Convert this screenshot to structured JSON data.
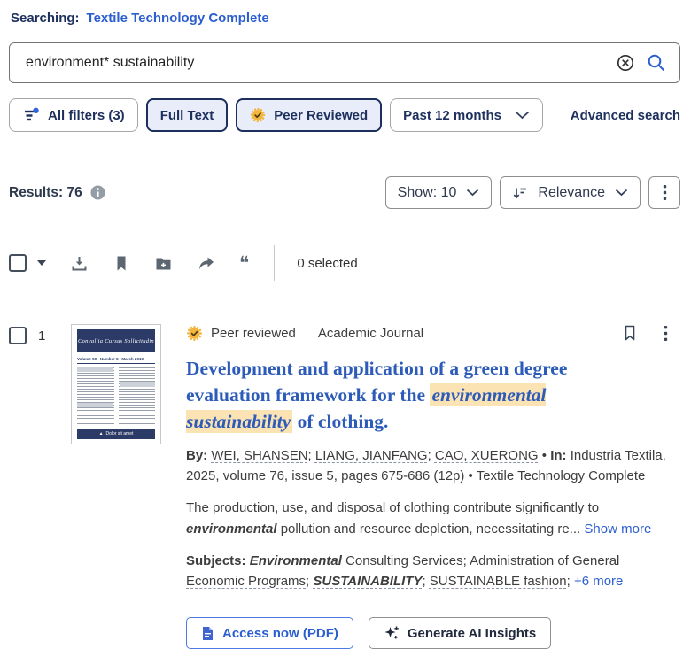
{
  "colors": {
    "navy": "#1c2f5d",
    "link_blue": "#2b5fd0",
    "title_blue": "#2d5bb9",
    "highlight": "#fbe3b4",
    "badge_gold": "#f3b53d",
    "icon_gray": "#5b6670",
    "selected_filter_bg": "#e8edf9"
  },
  "searching": {
    "label": "Searching:",
    "database_link": "Textile Technology Complete"
  },
  "search": {
    "value": "environment* sustainability",
    "clear_icon": "circled-x",
    "submit_icon": "magnifier"
  },
  "filters": {
    "all_filters_label": "All filters (3)",
    "full_text_label": "Full Text",
    "peer_reviewed_label": "Peer Reviewed",
    "date_label": "Past 12 months",
    "advanced_search_label": "Advanced search"
  },
  "results_bar": {
    "results_label": "Results: 76",
    "show_label": "Show: 10",
    "sort_label": "Relevance"
  },
  "bulk_bar": {
    "selected_count": "0 selected"
  },
  "result": {
    "number": "1",
    "peer_reviewed_label": "Peer reviewed",
    "source_type": "Academic Journal",
    "title_parts": [
      {
        "t": "Development and application of a green degree evaluation framework for the ",
        "n": "title-text"
      },
      {
        "t": "environmental sustainability",
        "c": "hl",
        "n": "highlighted-term"
      },
      {
        "t": " of clothing.",
        "n": "title-text"
      }
    ],
    "byline_parts": [
      {
        "t": "By: ",
        "c": "b",
        "n": "by-label"
      },
      {
        "t": "WEI, SHANSEN",
        "c": "dotted",
        "n": "author-link",
        "i": true
      },
      {
        "t": "; ",
        "n": "separator"
      },
      {
        "t": "LIANG, JIANFANG",
        "c": "dotted",
        "n": "author-link",
        "i": true
      },
      {
        "t": "; ",
        "n": "separator"
      },
      {
        "t": "CAO, XUERONG",
        "c": "dotted",
        "n": "author-link",
        "i": true
      },
      {
        "t": " • ",
        "n": "separator"
      },
      {
        "t": "In:",
        "c": "b",
        "n": "in-label"
      },
      {
        "t": " Industria Textila, 2025, volume 76, issue 5, pages 675-686 (12p) • Textile Technology Complete",
        "n": "source-citation"
      }
    ],
    "abstract_parts": [
      {
        "t": "The production, use, and disposal of clothing contribute significantly to ",
        "n": "abstract-text"
      },
      {
        "t": "environmental",
        "c": "bi",
        "n": "matched-term"
      },
      {
        "t": " pollution and resource depletion, necessitating re",
        "n": "abstract-text"
      },
      {
        "t": "... ",
        "n": "ellipsis"
      },
      {
        "t": "Show more",
        "c": "link dotted-blue",
        "n": "show-more-link",
        "i": true
      }
    ],
    "subjects_parts": [
      {
        "t": "Subjects: ",
        "c": "b",
        "n": "subjects-label"
      },
      {
        "t": "Environmental",
        "c": "bi dotted",
        "n": "subject-link",
        "i": true
      },
      {
        "t": " Consulting Services",
        "c": "dotted",
        "n": "subject-link",
        "i": true
      },
      {
        "t": "; ",
        "n": "separator"
      },
      {
        "t": "Administration of General Economic Programs",
        "c": "dotted",
        "n": "subject-link",
        "i": true
      },
      {
        "t": "; ",
        "n": "separator"
      },
      {
        "t": "SUSTAINABILITY",
        "c": "bi dotted",
        "n": "subject-link",
        "i": true
      },
      {
        "t": "; ",
        "n": "separator"
      },
      {
        "t": "SUSTAINABLE fashion",
        "c": "dotted",
        "n": "subject-link",
        "i": true
      },
      {
        "t": "; ",
        "n": "separator"
      },
      {
        "t": "+6 more",
        "c": "link",
        "n": "more-subjects-link",
        "i": true
      }
    ],
    "thumbnail": {
      "journal_title": "Convallia Cursus Sollicitudin",
      "issue_line": "Volume 59   Number 8   March 2010",
      "footer_triangle": "▲",
      "footer_text": "Dolor sit amet"
    },
    "access_button_label": "Access now (PDF)",
    "ai_button_label": "Generate AI Insights"
  }
}
